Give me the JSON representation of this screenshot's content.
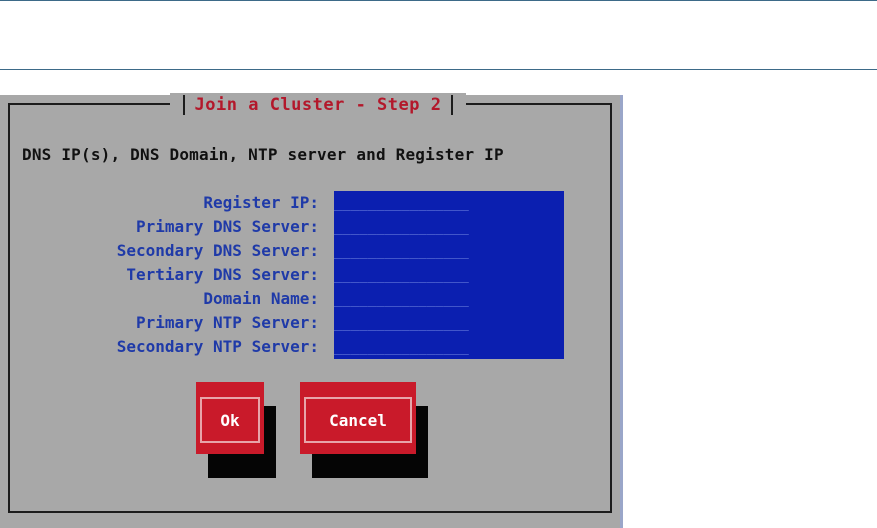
{
  "window": {
    "title": "Join a Cluster - Step 2",
    "heading": "DNS IP(s), DNS Domain, NTP server and Register IP"
  },
  "fields": [
    {
      "label": "Register IP:",
      "value": "",
      "placeholder": "________________"
    },
    {
      "label": "Primary DNS Server:",
      "value": "",
      "placeholder": "________________"
    },
    {
      "label": "Secondary DNS Server:",
      "value": "",
      "placeholder": "________________"
    },
    {
      "label": "Tertiary DNS Server:",
      "value": "",
      "placeholder": "________________"
    },
    {
      "label": "Domain Name:",
      "value": "",
      "placeholder": "________________"
    },
    {
      "label": "Primary NTP Server:",
      "value": "",
      "placeholder": "________________"
    },
    {
      "label": "Secondary NTP Server:",
      "value": "",
      "placeholder": "________________"
    }
  ],
  "buttons": {
    "ok_label": "Ok",
    "cancel_label": "Cancel"
  },
  "colors": {
    "screen_bg": "#a8a8a8",
    "title": "#b3182b",
    "field_label": "#1f3aa8",
    "input_bg": "#0b1fb0",
    "button_bg": "#c91a2a"
  }
}
